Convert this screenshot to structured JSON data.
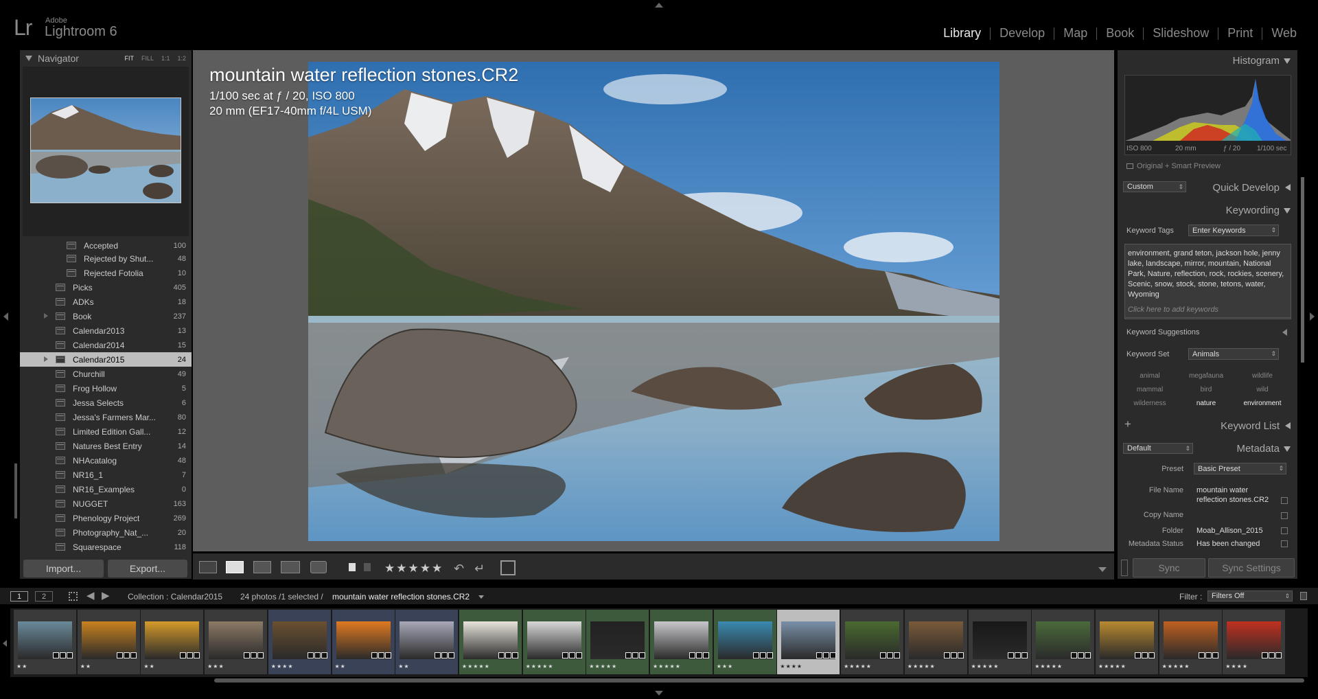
{
  "app": {
    "logo": "Lr",
    "vendor": "Adobe",
    "name": "Lightroom 6"
  },
  "modules": [
    {
      "label": "Library",
      "active": true
    },
    {
      "label": "Develop"
    },
    {
      "label": "Map"
    },
    {
      "label": "Book"
    },
    {
      "label": "Slideshow"
    },
    {
      "label": "Print"
    },
    {
      "label": "Web"
    }
  ],
  "navigator": {
    "title": "Navigator",
    "zoom": [
      "FIT",
      "FILL",
      "1:1",
      "1:2"
    ]
  },
  "folders": [
    {
      "name": "Accepted",
      "count": "100",
      "level": 2
    },
    {
      "name": "Rejected by Shut...",
      "count": "48",
      "level": 2
    },
    {
      "name": "Rejected Fotolia",
      "count": "10",
      "level": 2
    },
    {
      "name": "Picks",
      "count": "405",
      "level": 1
    },
    {
      "name": "ADKs",
      "count": "18",
      "level": 1
    },
    {
      "name": "Book",
      "count": "237",
      "level": 1,
      "expand": true
    },
    {
      "name": "Calendar2013",
      "count": "13",
      "level": 1
    },
    {
      "name": "Calendar2014",
      "count": "15",
      "level": 1
    },
    {
      "name": "Calendar2015",
      "count": "24",
      "level": 1,
      "selected": true,
      "expand": true
    },
    {
      "name": "Churchill",
      "count": "49",
      "level": 1
    },
    {
      "name": "Frog Hollow",
      "count": "5",
      "level": 1
    },
    {
      "name": "Jessa Selects",
      "count": "6",
      "level": 1
    },
    {
      "name": "Jessa's Farmers Mar...",
      "count": "80",
      "level": 1
    },
    {
      "name": "Limited Edition Gall...",
      "count": "12",
      "level": 1
    },
    {
      "name": "Natures Best Entry",
      "count": "14",
      "level": 1
    },
    {
      "name": "NHAcatalog",
      "count": "48",
      "level": 1
    },
    {
      "name": "NR16_1",
      "count": "7",
      "level": 1
    },
    {
      "name": "NR16_Examples",
      "count": "0",
      "level": 1
    },
    {
      "name": "NUGGET",
      "count": "163",
      "level": 1
    },
    {
      "name": "Phenology Project",
      "count": "269",
      "level": 1
    },
    {
      "name": "Photography_Nat_...",
      "count": "20",
      "level": 1
    },
    {
      "name": "Squarespace",
      "count": "118",
      "level": 1
    }
  ],
  "left_buttons": {
    "import": "Import...",
    "export": "Export..."
  },
  "photo_info": {
    "filename": "mountain water reflection stones.CR2",
    "exposure": "1/100 sec at ƒ / 20, ISO 800",
    "lens": "20 mm (EF17-40mm f/4L USM)"
  },
  "toolbar": {
    "rating": "★★★★★"
  },
  "histogram": {
    "title": "Histogram",
    "iso": "ISO 800",
    "focal": "20 mm",
    "aperture": "ƒ / 20",
    "shutter": "1/100 sec",
    "preview": "Original + Smart Preview"
  },
  "quick_develop": {
    "title": "Quick Develop",
    "preset": "Custom"
  },
  "keywording": {
    "title": "Keywording",
    "tags_label": "Keyword Tags",
    "tags_mode": "Enter Keywords",
    "keywords": "environment, grand teton, jackson hole, jenny lake, landscape, mirror, mountain, National Park, Nature, reflection, rock, rockies, scenery, Scenic, snow, stock, stone, tetons, water, Wyoming",
    "add_hint": "Click here to add keywords",
    "suggestions": "Keyword Suggestions",
    "set_label": "Keyword Set",
    "set_value": "Animals",
    "set_items": [
      "animal",
      "megafauna",
      "wildlife",
      "mammal",
      "bird",
      "wild",
      "wilderness",
      "nature",
      "environment"
    ]
  },
  "keyword_list": {
    "title": "Keyword List",
    "add": "+"
  },
  "metadata": {
    "title": "Metadata",
    "preset_dd": "Default",
    "preset_label": "Preset",
    "preset_value": "Basic Preset",
    "filename_label": "File Name",
    "filename_value1": "mountain water",
    "filename_value2": "reflection stones.CR2",
    "copyname_label": "Copy Name",
    "folder_label": "Folder",
    "folder_value": "Moab_Allison_2015",
    "status_label": "Metadata Status",
    "status_value": "Has been changed"
  },
  "sync": {
    "sync": "Sync",
    "sync_settings": "Sync Settings"
  },
  "filmstrip_bar": {
    "screen1": "1",
    "screen2": "2",
    "collection": "Collection : Calendar2015",
    "count": "24 photos /1 selected /",
    "selected_file": "mountain water reflection stones.CR2",
    "filter_label": "Filter :",
    "filter_value": "Filters Off"
  },
  "filmstrip": [
    {
      "stars": "★★",
      "color": "#6a8a9a"
    },
    {
      "stars": "★★",
      "color": "#c9821f"
    },
    {
      "stars": "★★",
      "color": "#d49a2a"
    },
    {
      "stars": "★★★",
      "color": "#8c7a66"
    },
    {
      "stars": "★★★★",
      "color": "#6a5030"
    },
    {
      "stars": "★★",
      "color": "#e07a20"
    },
    {
      "stars": "★★",
      "color": "#a8a8b8"
    },
    {
      "stars": "★★★★★",
      "color": "#e8e4dc"
    },
    {
      "stars": "★★★★★",
      "color": "#d8d8d8"
    },
    {
      "stars": "★★★★★",
      "color": "#222222"
    },
    {
      "stars": "★★★★★",
      "color": "#c8c8cc"
    },
    {
      "stars": "★★★",
      "color": "#3a8ab0"
    },
    {
      "stars": "★★★★",
      "color": "#7a90a8"
    },
    {
      "stars": "★★★★★",
      "color": "#4a6a30"
    },
    {
      "stars": "★★★★★",
      "color": "#7a5a3a"
    },
    {
      "stars": "★★★★★",
      "color": "#181818"
    },
    {
      "stars": "★★★★★",
      "color": "#4a6a3a"
    },
    {
      "stars": "★★★★★",
      "color": "#b88a30"
    },
    {
      "stars": "★★★★★",
      "color": "#c06020"
    },
    {
      "stars": "★★★★",
      "color": "#c03020"
    }
  ]
}
